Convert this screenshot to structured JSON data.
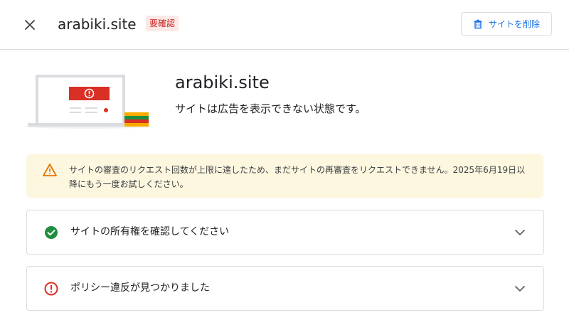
{
  "header": {
    "site_name": "arabiki.site",
    "status_badge": "要確認",
    "remove_button_label": "サイトを削除"
  },
  "summary": {
    "title": "arabiki.site",
    "subtitle": "サイトは広告を表示できない状態です。"
  },
  "warning": {
    "text": "サイトの審査のリクエスト回数が上限に達したため、まだサイトの再審査をリクエストできません。2025年6月19日以降にもう一度お試しください。"
  },
  "checks": [
    {
      "label": "サイトの所有権を確認してください",
      "status": "complete",
      "icon": "check-circle-icon"
    },
    {
      "label": "ポリシー違反が見つかりました",
      "status": "error",
      "icon": "error-circle-icon"
    }
  ],
  "colors": {
    "accent": "#1a73e8",
    "error": "#d93025",
    "success": "#1e8e3e",
    "warning_bg": "#fef7e0",
    "warning_icon": "#e37400",
    "badge_bg": "#fce8e6"
  }
}
